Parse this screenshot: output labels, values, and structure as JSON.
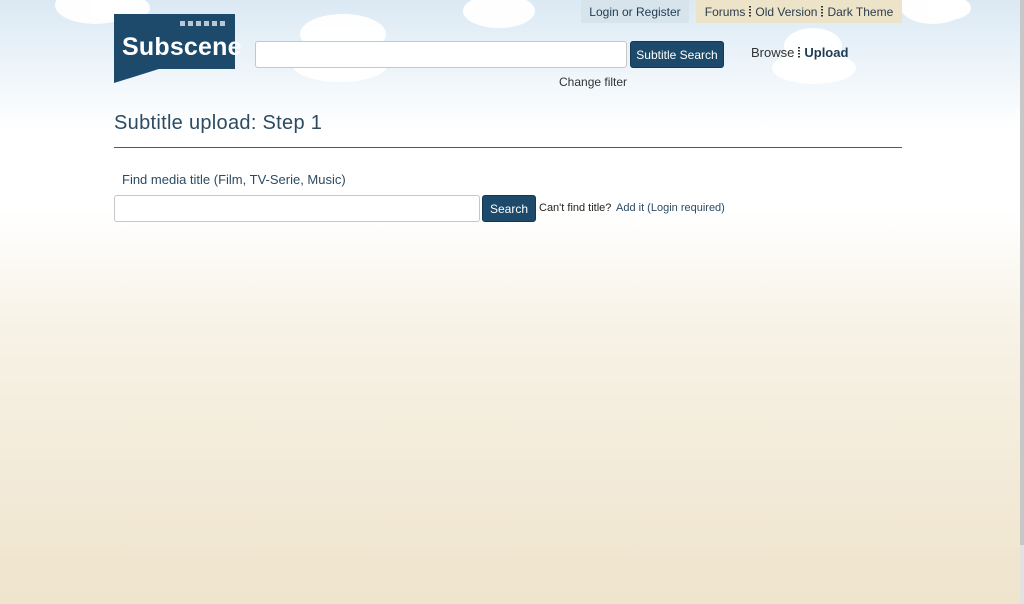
{
  "top_bar": {
    "login_label": "Login or Register",
    "links": [
      "Forums",
      "Old Version",
      "Dark Theme"
    ]
  },
  "logo": {
    "text": "Subscene"
  },
  "header_search": {
    "value": "",
    "placeholder": "",
    "button_label": "Subtitle Search",
    "change_filter_label": "Change filter"
  },
  "main_nav": {
    "browse_label": "Browse",
    "upload_label": "Upload"
  },
  "page": {
    "title": "Subtitle upload: Step 1",
    "find_label": "Find media title (Film, TV-Serie, Music)",
    "search_value": "",
    "search_placeholder": "",
    "search_button_label": "Search",
    "cant_find_text": "Can't find title?",
    "add_it_label": "Add it (Login required)"
  },
  "colors": {
    "brand": "#1d4a6a",
    "title_text": "#2b4b63",
    "top_bar_left_bg": "#d8e4ec",
    "top_bar_right_bg": "#ece3c9"
  }
}
